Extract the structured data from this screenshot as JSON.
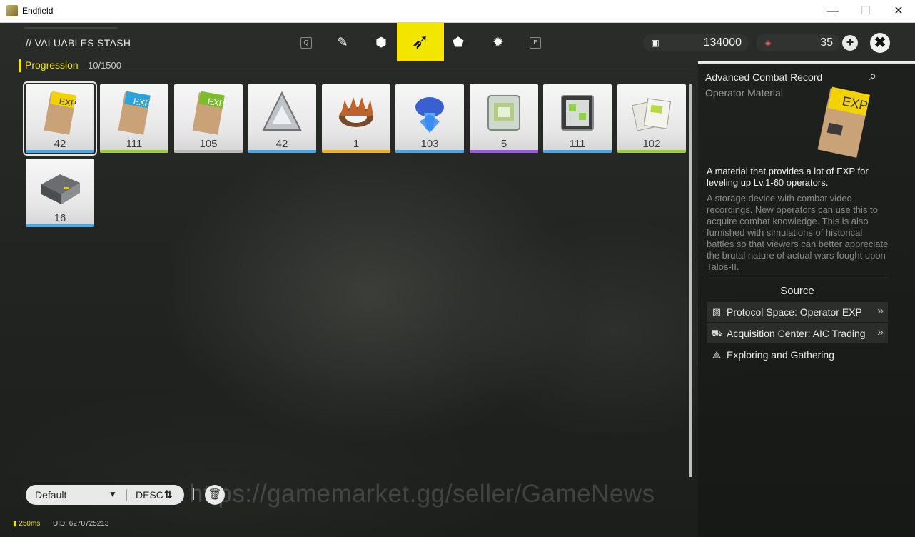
{
  "window": {
    "title": "Endfield",
    "minimize": "—",
    "maximize": "☐",
    "close": "✕"
  },
  "stash": {
    "title": "// VALUABLES STASH",
    "category": "Progression",
    "count": "10/1500"
  },
  "tabs": [
    {
      "icon": "q-key-icon",
      "glyph": "Q"
    },
    {
      "icon": "weapon-icon",
      "glyph": "✎"
    },
    {
      "icon": "cube-icon",
      "glyph": "⬢"
    },
    {
      "icon": "valuables-cursor-icon",
      "glyph": "➶"
    },
    {
      "icon": "shapes-icon",
      "glyph": "⬟"
    },
    {
      "icon": "gear-icon",
      "glyph": "✹"
    },
    {
      "icon": "e-key-icon",
      "glyph": "E"
    }
  ],
  "currency": [
    {
      "icon": "money-card-icon",
      "glyph": "▣",
      "value": "134000"
    },
    {
      "icon": "originium-icon",
      "glyph": "◈",
      "value": "35"
    }
  ],
  "buttons": {
    "plus": "+",
    "close": "✖"
  },
  "items": [
    {
      "name": "Advanced Combat Record",
      "qty": "42",
      "rarity": "#4aa8e8",
      "art": "exp-card-gold"
    },
    {
      "name": "EXP record blue",
      "qty": "111",
      "rarity": "#9ccf3a",
      "art": "exp-card-blue"
    },
    {
      "name": "EXP record green",
      "qty": "105",
      "rarity": "#bdbdbd",
      "art": "exp-card-green"
    },
    {
      "name": "Triangle shard",
      "qty": "42",
      "rarity": "#4aa8e8",
      "art": "triangle"
    },
    {
      "name": "Crown",
      "qty": "1",
      "rarity": "#f2b21a",
      "art": "crown"
    },
    {
      "name": "Blue crystal",
      "qty": "103",
      "rarity": "#4aa8e8",
      "art": "crystal"
    },
    {
      "name": "Cube module",
      "qty": "5",
      "rarity": "#9b5de5",
      "art": "cube"
    },
    {
      "name": "Circuit module",
      "qty": "111",
      "rarity": "#4aa8e8",
      "art": "circuit"
    },
    {
      "name": "Data cards",
      "qty": "102",
      "rarity": "#9ccf3a",
      "art": "cards"
    },
    {
      "name": "Tray",
      "qty": "16",
      "rarity": "#4aa8e8",
      "art": "tray"
    }
  ],
  "detail": {
    "name": "Advanced Combat Record",
    "type": "Operator Material",
    "summary": "A material that provides a lot of EXP for leveling up Lv.1-60 operators.",
    "description": "A storage device with combat video recordings. New operators can use this to acquire combat knowledge. This is also furnished with simulations of historical battles so that viewers can better appreciate the brutal nature of actual wars fought upon Talos-II.",
    "source_heading": "Source",
    "sources": [
      {
        "label": "Protocol Space: Operator EXP",
        "icon": "protocol-icon",
        "glyph": "▨",
        "arrow": "»"
      },
      {
        "label": "Acquisition Center: AIC Trading",
        "icon": "cart-icon",
        "glyph": "⛟",
        "arrow": "»"
      },
      {
        "label": "Exploring and Gathering",
        "icon": "explore-icon",
        "glyph": "⟁",
        "arrow": ""
      }
    ]
  },
  "sort": {
    "default": "Default",
    "caret": "▼",
    "order": "DESC",
    "order_icon": "⇅"
  },
  "trash": "🗑",
  "watermark": "https://gamemarket.gg/seller/GameNews",
  "status": {
    "ping": "250ms",
    "uid": "UID: 6270725213"
  }
}
